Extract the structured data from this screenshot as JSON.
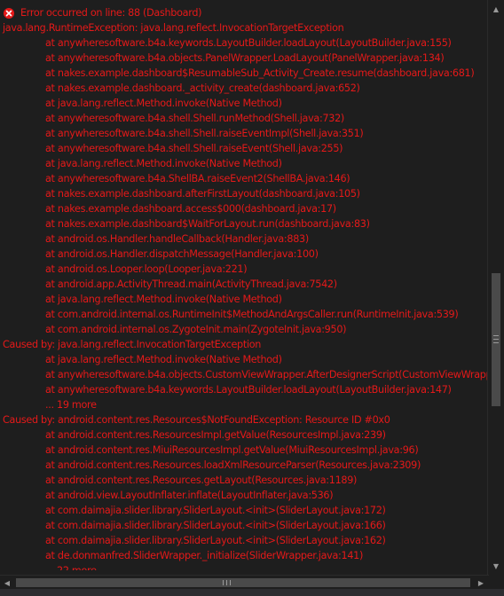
{
  "top_partial_line": "",
  "error_header": {
    "icon": "error-circle-icon",
    "text": "Error occurred on line: 88 (Dashboard)"
  },
  "log_lines": [
    {
      "level": 0,
      "text": "java.lang.RuntimeException: java.lang.reflect.InvocationTargetException"
    },
    {
      "level": 1,
      "text": "at anywheresoftware.b4a.keywords.LayoutBuilder.loadLayout(LayoutBuilder.java:155)"
    },
    {
      "level": 1,
      "text": "at anywheresoftware.b4a.objects.PanelWrapper.LoadLayout(PanelWrapper.java:134)"
    },
    {
      "level": 1,
      "text": "at nakes.example.dashboard$ResumableSub_Activity_Create.resume(dashboard.java:681)"
    },
    {
      "level": 1,
      "text": "at nakes.example.dashboard._activity_create(dashboard.java:652)"
    },
    {
      "level": 1,
      "text": "at java.lang.reflect.Method.invoke(Native Method)"
    },
    {
      "level": 1,
      "text": "at anywheresoftware.b4a.shell.Shell.runMethod(Shell.java:732)"
    },
    {
      "level": 1,
      "text": "at anywheresoftware.b4a.shell.Shell.raiseEventImpl(Shell.java:351)"
    },
    {
      "level": 1,
      "text": "at anywheresoftware.b4a.shell.Shell.raiseEvent(Shell.java:255)"
    },
    {
      "level": 1,
      "text": "at java.lang.reflect.Method.invoke(Native Method)"
    },
    {
      "level": 1,
      "text": "at anywheresoftware.b4a.ShellBA.raiseEvent2(ShellBA.java:146)"
    },
    {
      "level": 1,
      "text": "at nakes.example.dashboard.afterFirstLayout(dashboard.java:105)"
    },
    {
      "level": 1,
      "text": "at nakes.example.dashboard.access$000(dashboard.java:17)"
    },
    {
      "level": 1,
      "text": "at nakes.example.dashboard$WaitForLayout.run(dashboard.java:83)"
    },
    {
      "level": 1,
      "text": "at android.os.Handler.handleCallback(Handler.java:883)"
    },
    {
      "level": 1,
      "text": "at android.os.Handler.dispatchMessage(Handler.java:100)"
    },
    {
      "level": 1,
      "text": "at android.os.Looper.loop(Looper.java:221)"
    },
    {
      "level": 1,
      "text": "at android.app.ActivityThread.main(ActivityThread.java:7542)"
    },
    {
      "level": 1,
      "text": "at java.lang.reflect.Method.invoke(Native Method)"
    },
    {
      "level": 1,
      "text": "at com.android.internal.os.RuntimeInit$MethodAndArgsCaller.run(RuntimeInit.java:539)"
    },
    {
      "level": 1,
      "text": "at com.android.internal.os.ZygoteInit.main(ZygoteInit.java:950)"
    },
    {
      "level": 0,
      "text": "Caused by: java.lang.reflect.InvocationTargetException"
    },
    {
      "level": 1,
      "text": "at java.lang.reflect.Method.invoke(Native Method)"
    },
    {
      "level": 1,
      "text": "at anywheresoftware.b4a.objects.CustomViewWrapper.AfterDesignerScript(CustomViewWrapp"
    },
    {
      "level": 1,
      "text": "at anywheresoftware.b4a.keywords.LayoutBuilder.loadLayout(LayoutBuilder.java:147)"
    },
    {
      "level": 1,
      "text": "... 19 more"
    },
    {
      "level": 0,
      "text": "Caused by: android.content.res.Resources$NotFoundException: Resource ID #0x0"
    },
    {
      "level": 1,
      "text": "at android.content.res.ResourcesImpl.getValue(ResourcesImpl.java:239)"
    },
    {
      "level": 1,
      "text": "at android.content.res.MiuiResourcesImpl.getValue(MiuiResourcesImpl.java:96)"
    },
    {
      "level": 1,
      "text": "at android.content.res.Resources.loadXmlResourceParser(Resources.java:2309)"
    },
    {
      "level": 1,
      "text": "at android.content.res.Resources.getLayout(Resources.java:1189)"
    },
    {
      "level": 1,
      "text": "at android.view.LayoutInflater.inflate(LayoutInflater.java:536)"
    },
    {
      "level": 1,
      "text": "at com.daimajia.slider.library.SliderLayout.<init>(SliderLayout.java:172)"
    },
    {
      "level": 1,
      "text": "at com.daimajia.slider.library.SliderLayout.<init>(SliderLayout.java:166)"
    },
    {
      "level": 1,
      "text": "at com.daimajia.slider.library.SliderLayout.<init>(SliderLayout.java:162)"
    },
    {
      "level": 1,
      "text": "at de.donmanfred.SliderWrapper._initialize(SliderWrapper.java:141)"
    },
    {
      "level": 1,
      "text": "... 22 more"
    }
  ],
  "colors": {
    "background": "#1e1e1e",
    "error_text": "#e51919",
    "scrollbar_thumb": "#4a4a4a",
    "scrollbar_arrow": "#999999"
  },
  "scrollbars": {
    "vertical": {
      "up_icon": "triangle-up-icon",
      "down_icon": "triangle-down-icon",
      "grip_icon": "grip-lines-icon"
    },
    "horizontal": {
      "left_icon": "triangle-left-icon",
      "right_icon": "triangle-right-icon",
      "grip_icon": "grip-lines-icon"
    }
  }
}
